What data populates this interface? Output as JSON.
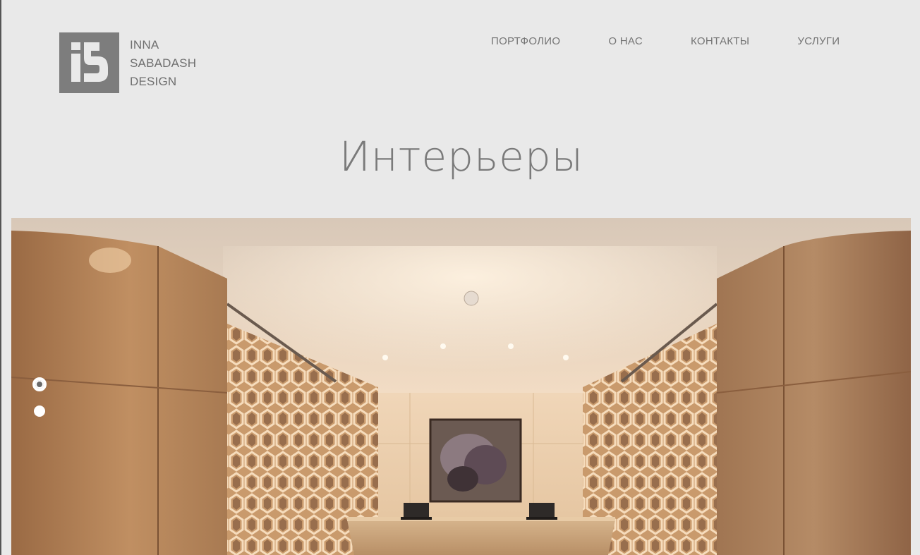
{
  "brand": {
    "logo_icon": "is-monogram",
    "name_lines": [
      "INNA",
      "SABADASH",
      "DESIGN"
    ],
    "logo_color": "#7d7d7d"
  },
  "nav": {
    "items": [
      {
        "label": "ПОРТФОЛИО"
      },
      {
        "label": "О НАС"
      },
      {
        "label": "КОНТАКТЫ"
      },
      {
        "label": "УСЛУГИ"
      }
    ]
  },
  "page": {
    "title": "Интерьеры",
    "background": "#e9e9e9"
  },
  "slider": {
    "slide_count": 2,
    "active_index": 0,
    "slide_image": "hotel-lobby-interior"
  }
}
